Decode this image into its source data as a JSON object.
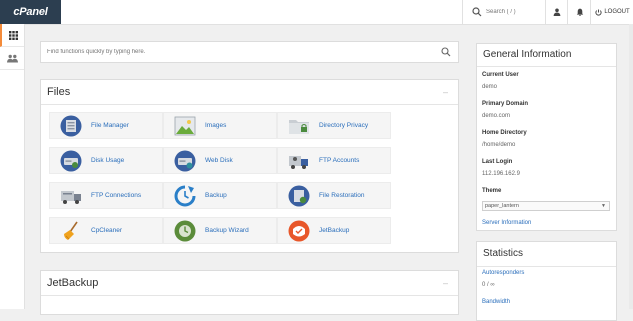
{
  "brand": {
    "logo_text": "cPanel"
  },
  "topbar": {
    "search_placeholder": "Search ( / )",
    "logout_label": "LOGOUT"
  },
  "function_search": {
    "placeholder": "Find functions quickly by typing here."
  },
  "files_panel": {
    "title": "Files",
    "collapse": "–",
    "items": [
      {
        "label": "File Manager",
        "icon": "file-manager-icon"
      },
      {
        "label": "Images",
        "icon": "images-icon"
      },
      {
        "label": "Directory Privacy",
        "icon": "directory-privacy-icon"
      },
      {
        "label": "Disk Usage",
        "icon": "disk-usage-icon"
      },
      {
        "label": "Web Disk",
        "icon": "web-disk-icon"
      },
      {
        "label": "FTP Accounts",
        "icon": "ftp-accounts-icon"
      },
      {
        "label": "FTP Connections",
        "icon": "ftp-connections-icon"
      },
      {
        "label": "Backup",
        "icon": "backup-icon"
      },
      {
        "label": "File Restoration",
        "icon": "file-restoration-icon"
      },
      {
        "label": "CpCleaner",
        "icon": "cpcleaner-icon"
      },
      {
        "label": "Backup Wizard",
        "icon": "backup-wizard-icon"
      },
      {
        "label": "JetBackup",
        "icon": "jetbackup-icon"
      }
    ]
  },
  "jetbackup_panel": {
    "title": "JetBackup",
    "collapse": "–"
  },
  "general_info": {
    "title": "General Information",
    "current_user_label": "Current User",
    "current_user": "demo",
    "primary_domain_label": "Primary Domain",
    "primary_domain": "demo.com",
    "home_directory_label": "Home Directory",
    "home_directory": "/home/demo",
    "last_login_label": "Last Login",
    "last_login": "112.196.162.9",
    "theme_label": "Theme",
    "theme_value": "paper_lantern",
    "server_info_link": "Server Information"
  },
  "statistics": {
    "title": "Statistics",
    "autoresponders_label": "Autoresponders",
    "autoresponders_value": "0 / ∞",
    "bandwidth_label": "Bandwidth"
  },
  "colors": {
    "accent": "#f48b3a",
    "link": "#2a6ebb",
    "logo_bg": "#2c3e50"
  }
}
